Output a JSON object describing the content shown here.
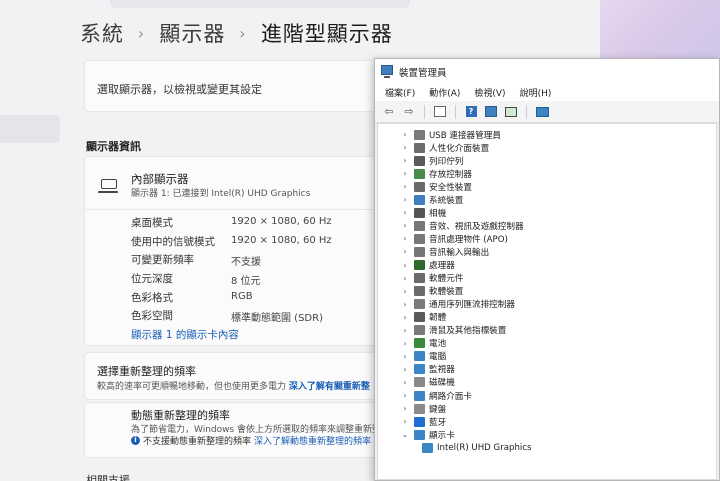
{
  "settings": {
    "breadcrumb": [
      "系統",
      "顯示器",
      "進階型顯示器"
    ],
    "breadcrumb_sep": "›",
    "select_display_label": "選取顯示器，以檢視或變更其設定",
    "section_title": "顯示器資訊",
    "display_name": "內部顯示器",
    "display_sub": "顯示器 1: 已連接到 Intel(R) UHD Graphics",
    "properties": [
      {
        "label": "桌面模式",
        "value": "1920 × 1080, 60 Hz"
      },
      {
        "label": "使用中的信號模式",
        "value": "1920 × 1080, 60 Hz"
      },
      {
        "label": "可變更新頻率",
        "value": "不支援"
      },
      {
        "label": "位元深度",
        "value": "8 位元"
      },
      {
        "label": "色彩格式",
        "value": "RGB"
      },
      {
        "label": "色彩空間",
        "value": "標準動態範圍 (SDR)"
      }
    ],
    "adapter_link": "顯示器 1 的顯示卡內容",
    "refresh_title": "選擇重新整理的頻率",
    "refresh_desc": "較高的速率可更順暢地移動，但也使用更多電力",
    "refresh_link": "深入了解有關重新整",
    "dynamic_title": "動態重新整理的頻率",
    "dynamic_desc": "為了節省電力，Windows 會依上方所選取的頻率來調整重新整理",
    "dynamic_note": "不支援動態重新整理的頻率",
    "dynamic_link": "深入了解動態重新整理的頻率",
    "info_glyph": "i",
    "bottom_cut": "相關支援"
  },
  "device_manager": {
    "title": "裝置管理員",
    "menus": [
      "檔案(F)",
      "動作(A)",
      "檢視(V)",
      "說明(H)"
    ],
    "toolbar": {
      "back_glyph": "⇦",
      "forward_glyph": "⇨",
      "help_glyph": "?"
    },
    "collapsed_arrow": "›",
    "expanded_arrow": "⌄",
    "tree": [
      {
        "label": "USB 連接器管理員",
        "icon": "usb-connector-icon",
        "color": "#7a7a7a"
      },
      {
        "label": "人性化介面裝置",
        "icon": "hid-icon",
        "color": "#6d6d6d"
      },
      {
        "label": "列印佇列",
        "icon": "printer-icon",
        "color": "#5b5b5b"
      },
      {
        "label": "存放控制器",
        "icon": "storage-controller-icon",
        "color": "#4a8a4a"
      },
      {
        "label": "安全性裝置",
        "icon": "security-device-icon",
        "color": "#6a6a6a"
      },
      {
        "label": "系統裝置",
        "icon": "system-device-icon",
        "color": "#3f7fbf"
      },
      {
        "label": "相機",
        "icon": "camera-icon",
        "color": "#555555"
      },
      {
        "label": "音效、視訊及遊戲控制器",
        "icon": "sound-icon",
        "color": "#777777"
      },
      {
        "label": "音訊處理物件 (APO)",
        "icon": "apo-icon",
        "color": "#777777"
      },
      {
        "label": "音訊輸入與輸出",
        "icon": "audio-io-icon",
        "color": "#777777"
      },
      {
        "label": "處理器",
        "icon": "processor-icon",
        "color": "#2e6a2e"
      },
      {
        "label": "軟體元件",
        "icon": "software-component-icon",
        "color": "#6b6b6b"
      },
      {
        "label": "軟體裝置",
        "icon": "software-device-icon",
        "color": "#6b6b6b"
      },
      {
        "label": "通用序列匯流排控制器",
        "icon": "usb-controller-icon",
        "color": "#7a7a7a"
      },
      {
        "label": "韌體",
        "icon": "firmware-icon",
        "color": "#5a5a5a"
      },
      {
        "label": "滑鼠及其他指標裝置",
        "icon": "mouse-icon",
        "color": "#7a7a7a"
      },
      {
        "label": "電池",
        "icon": "battery-icon",
        "color": "#3a8a3a"
      },
      {
        "label": "電腦",
        "icon": "computer-icon",
        "color": "#3b86c6"
      },
      {
        "label": "監視器",
        "icon": "monitor-icon",
        "color": "#3b86c6"
      },
      {
        "label": "磁碟機",
        "icon": "disk-drive-icon",
        "color": "#8a8a8a"
      },
      {
        "label": "網路介面卡",
        "icon": "network-adapter-icon",
        "color": "#3b86c6"
      },
      {
        "label": "鍵盤",
        "icon": "keyboard-icon",
        "color": "#8a8a8a"
      },
      {
        "label": "藍牙",
        "icon": "bluetooth-icon",
        "color": "#1e6fd0"
      },
      {
        "label": "顯示卡",
        "icon": "display-adapter-icon",
        "color": "#3b86c6",
        "expanded": true
      },
      {
        "label": "Intel(R) UHD Graphics",
        "icon": "display-adapter-child-icon",
        "color": "#3b86c6",
        "child": true
      }
    ]
  }
}
